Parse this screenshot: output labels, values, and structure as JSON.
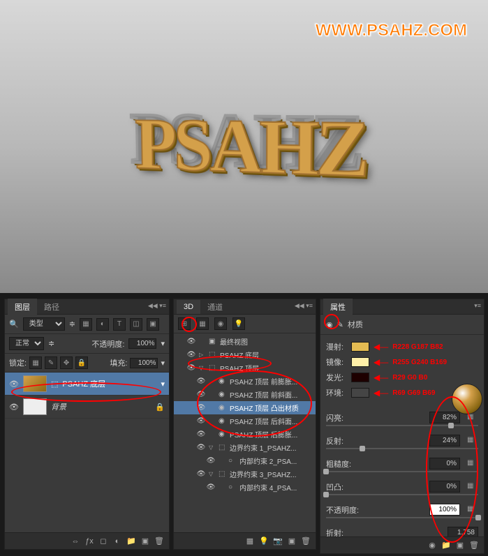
{
  "watermark": "WWW.PSAHZ.COM",
  "preview_text": "PSAHZ",
  "layers_panel": {
    "tabs": [
      "图层",
      "路径"
    ],
    "filter_label": "类型",
    "blend_mode": "正常",
    "opacity_label": "不透明度:",
    "opacity_value": "100%",
    "lock_label": "锁定:",
    "fill_label": "填充:",
    "fill_value": "100%",
    "layers": [
      {
        "name": "PSAHZ 底层",
        "selected": true
      },
      {
        "name": "背景",
        "selected": false,
        "italic": true
      }
    ]
  },
  "panel_3d": {
    "tabs": [
      "3D",
      "通道"
    ],
    "items": [
      {
        "label": "最终视图",
        "indent": 1,
        "icon": "camera"
      },
      {
        "label": "PSAHZ 底层",
        "indent": 1,
        "icon": "mesh",
        "toggle": "▷"
      },
      {
        "label": "PSAHZ 顶层",
        "indent": 1,
        "icon": "mesh",
        "toggle": "▽"
      },
      {
        "label": "PSAHZ 顶层 前膨胀...",
        "indent": 2,
        "icon": "mat"
      },
      {
        "label": "PSAHZ 顶层 前斜面...",
        "indent": 2,
        "icon": "mat"
      },
      {
        "label": "PSAHZ 顶层 凸出材质",
        "indent": 2,
        "icon": "mat",
        "selected": true
      },
      {
        "label": "PSAHZ 顶层 后斜面...",
        "indent": 2,
        "icon": "mat"
      },
      {
        "label": "PSAHZ 顶层 后膨胀...",
        "indent": 2,
        "icon": "mat"
      },
      {
        "label": "边界约束 1_PSAHZ...",
        "indent": 2,
        "icon": "mesh",
        "toggle": "▽"
      },
      {
        "label": "内部约束 2_PSA...",
        "indent": 3,
        "icon": "dot"
      },
      {
        "label": "边界约束 3_PSAHZ...",
        "indent": 2,
        "icon": "mesh",
        "toggle": "▽"
      },
      {
        "label": "内部约束 4_PSA...",
        "indent": 3,
        "icon": "dot"
      }
    ]
  },
  "props_panel": {
    "tab": "属性",
    "header": "材质",
    "colors": [
      {
        "label": "漫射:",
        "swatch": "#e4bb52",
        "annotation": "R228 G187 B82"
      },
      {
        "label": "镜像:",
        "swatch": "#fff0a9",
        "annotation": "R255 G240 B169"
      },
      {
        "label": "发光:",
        "swatch": "#1d0000",
        "annotation": "R29 G0 B0"
      },
      {
        "label": "环境:",
        "swatch": "#454545",
        "annotation": "R69 G69 B69"
      }
    ],
    "sliders": [
      {
        "label": "闪亮:",
        "value": "82%",
        "pct": 82,
        "extra": true
      },
      {
        "label": "反射:",
        "value": "24%",
        "pct": 24,
        "extra": true
      },
      {
        "label": "粗糙度:",
        "value": "0%",
        "pct": 0,
        "extra": true
      },
      {
        "label": "凹凸:",
        "value": "0%",
        "pct": 0,
        "extra": true
      },
      {
        "label": "不透明度:",
        "value": "100%",
        "pct": 100,
        "extra": true,
        "white": true
      },
      {
        "label": "折射:",
        "value": "1.758",
        "pct": 60,
        "extra": false
      }
    ]
  }
}
